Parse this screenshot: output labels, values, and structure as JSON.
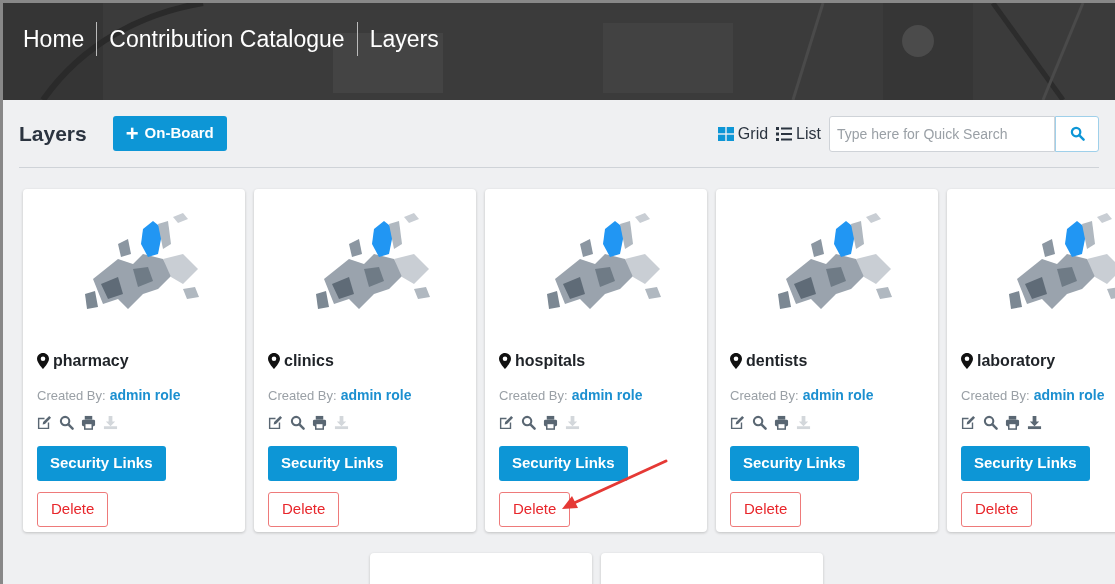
{
  "breadcrumb": [
    {
      "label": "Home"
    },
    {
      "label": "Contribution Catalogue"
    },
    {
      "label": "Layers"
    }
  ],
  "page_title": "Layers",
  "onboard_button": {
    "icon": "+",
    "label": "On-Board"
  },
  "view_options": [
    {
      "label": "Grid",
      "kind": "grid",
      "selected": true
    },
    {
      "label": "List",
      "kind": "list",
      "selected": false
    }
  ],
  "search": {
    "placeholder": "Type here for Quick Search"
  },
  "cards": [
    {
      "title": "pharmacy",
      "created_label": "Created By:",
      "creator": "admin role",
      "download_enabled": false,
      "security_button": "Security Links",
      "delete_button": "Delete",
      "pointed_by_arrow": false
    },
    {
      "title": "clinics",
      "created_label": "Created By:",
      "creator": "admin role",
      "download_enabled": false,
      "security_button": "Security Links",
      "delete_button": "Delete",
      "pointed_by_arrow": false
    },
    {
      "title": "hospitals",
      "created_label": "Created By:",
      "creator": "admin role",
      "download_enabled": false,
      "security_button": "Security Links",
      "delete_button": "Delete",
      "pointed_by_arrow": true
    },
    {
      "title": "dentists",
      "created_label": "Created By:",
      "creator": "admin role",
      "download_enabled": false,
      "security_button": "Security Links",
      "delete_button": "Delete",
      "pointed_by_arrow": false
    },
    {
      "title": "laboratory",
      "created_label": "Created By:",
      "creator": "admin role",
      "download_enabled": true,
      "security_button": "Security Links",
      "delete_button": "Delete",
      "pointed_by_arrow": false
    }
  ],
  "more_cards": [
    {
      "kind": "card"
    },
    {
      "kind": "card"
    }
  ]
}
